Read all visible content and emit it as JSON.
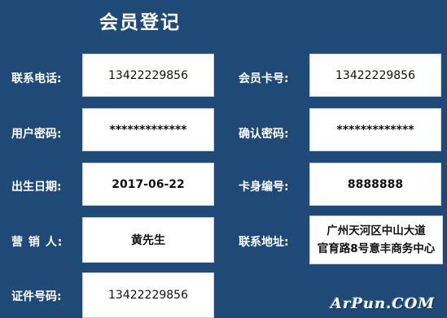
{
  "title": "会员登记",
  "labels": {
    "phone": "联系电话:",
    "card_no": "会员卡号:",
    "password": "用户密码:",
    "confirm_password": "确认密码:",
    "birthday": "出生日期:",
    "card_id": "卡身编号:",
    "salesperson": "营 销 人:",
    "address": "联系地址:",
    "id_no": "证件号码:"
  },
  "values": {
    "phone": "13422229856",
    "card_no": "13422229856",
    "password": "*************",
    "confirm_password": "*************",
    "birthday": "2017-06-22",
    "card_id": "8888888",
    "salesperson": "黄先生",
    "address_line1": "广州天河区中山大道",
    "address_line2": "官育路8号意丰商务中心",
    "id_no": "13422229856"
  },
  "watermark": "ArPun.COM"
}
